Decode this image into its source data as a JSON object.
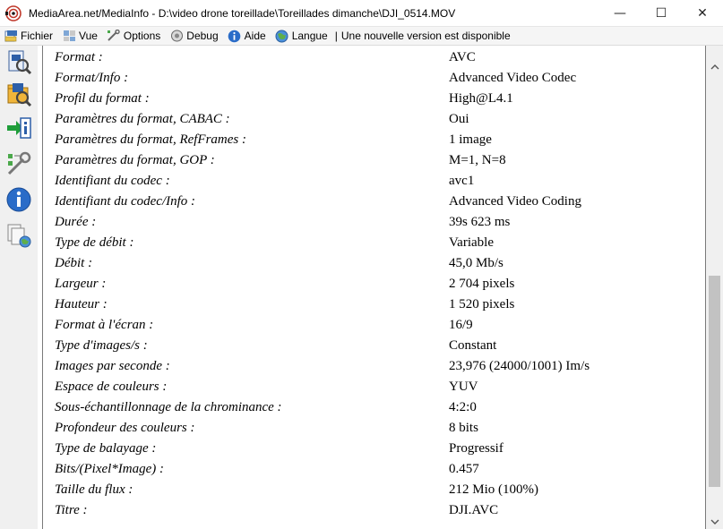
{
  "window": {
    "title": "MediaArea.net/MediaInfo - D:\\video drone toreillade\\Toreillades dimanche\\DJI_0514.MOV",
    "minimize_glyph": "—",
    "maximize_glyph": "☐",
    "close_glyph": "✕"
  },
  "menu": {
    "items": [
      {
        "label": "Fichier",
        "icon": "folder-icon"
      },
      {
        "label": "Vue",
        "icon": "view-icon"
      },
      {
        "label": "Options",
        "icon": "options-icon"
      },
      {
        "label": "Debug",
        "icon": "debug-icon"
      },
      {
        "label": "Aide",
        "icon": "help-icon"
      },
      {
        "label": "Langue",
        "icon": "globe-icon"
      }
    ],
    "separator": "|",
    "notice": "Une nouvelle version est disponible"
  },
  "toolbar": {
    "icons": [
      "open-file-icon",
      "open-folder-icon",
      "export-icon",
      "preferences-icon",
      "about-icon",
      "web-icon"
    ]
  },
  "details": {
    "rows": [
      {
        "label": "Format :",
        "value": "AVC"
      },
      {
        "label": "Format/Info :",
        "value": "Advanced Video Codec"
      },
      {
        "label": "Profil du format :",
        "value": "High@L4.1"
      },
      {
        "label": "Paramètres du format, CABAC :",
        "value": "Oui"
      },
      {
        "label": "Paramètres du format, RefFrames :",
        "value": "1 image"
      },
      {
        "label": "Paramètres du format, GOP :",
        "value": "M=1, N=8"
      },
      {
        "label": "Identifiant du codec :",
        "value": "avc1"
      },
      {
        "label": "Identifiant du codec/Info :",
        "value": "Advanced Video Coding"
      },
      {
        "label": "Durée :",
        "value": "39s 623 ms"
      },
      {
        "label": "Type de débit :",
        "value": "Variable"
      },
      {
        "label": "Débit :",
        "value": "45,0 Mb/s"
      },
      {
        "label": "Largeur :",
        "value": "2 704 pixels"
      },
      {
        "label": "Hauteur :",
        "value": "1 520 pixels"
      },
      {
        "label": "Format à l'écran :",
        "value": "16/9"
      },
      {
        "label": "Type d'images/s :",
        "value": "Constant"
      },
      {
        "label": "Images par seconde :",
        "value": "23,976 (24000/1001) Im/s"
      },
      {
        "label": "Espace de couleurs :",
        "value": "YUV"
      },
      {
        "label": "Sous-échantillonnage de la chrominance :",
        "value": "4:2:0"
      },
      {
        "label": "Profondeur des couleurs :",
        "value": "8 bits"
      },
      {
        "label": "Type de balayage :",
        "value": "Progressif"
      },
      {
        "label": "Bits/(Pixel*Image) :",
        "value": "0.457"
      },
      {
        "label": "Taille du flux :",
        "value": "212 Mio (100%)"
      },
      {
        "label": "Titre :",
        "value": "DJI.AVC"
      }
    ]
  },
  "scrollbar": {
    "up_glyph": "⌃",
    "down_glyph": "⌄",
    "position_fraction": 0.52
  }
}
